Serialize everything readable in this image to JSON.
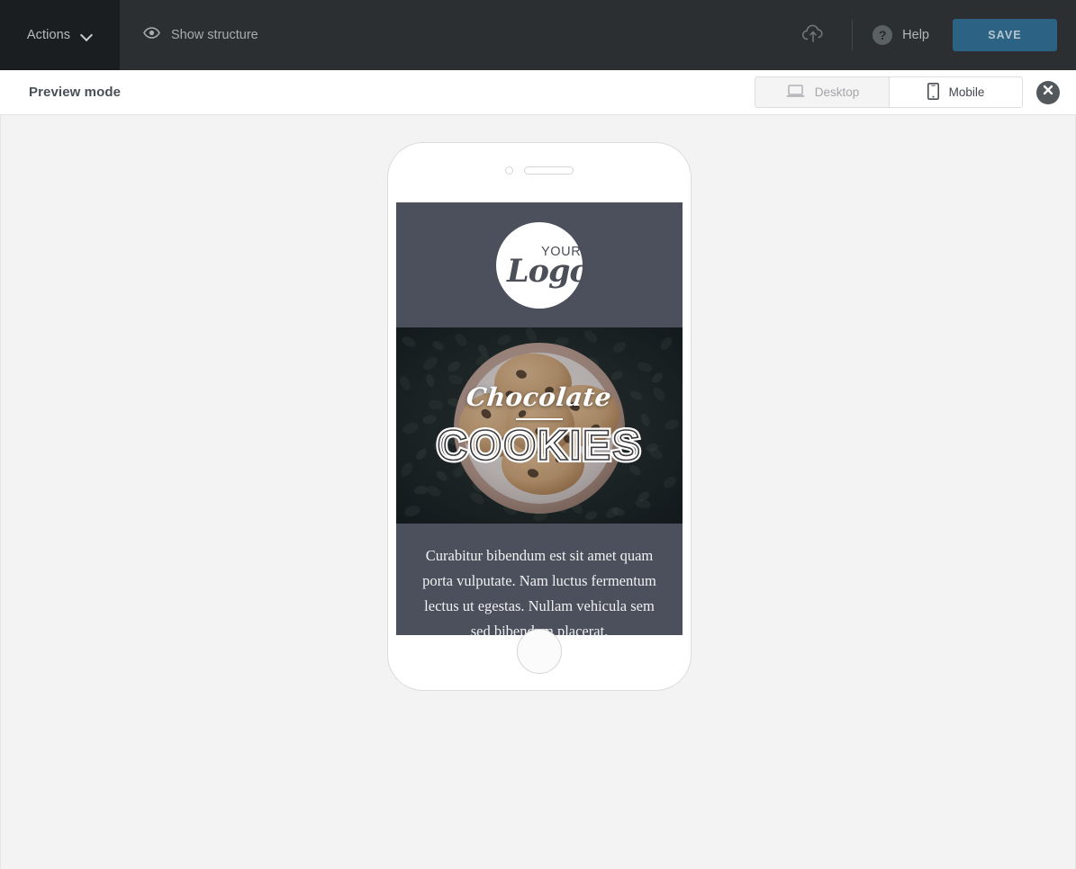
{
  "toolbar": {
    "actions_label": "Actions",
    "actions_chevron_icon": "chevron-down-icon",
    "show_structure_label": "Show structure",
    "show_structure_icon": "eye-icon",
    "upload_icon": "cloud-upload-icon",
    "help_label": "Help",
    "help_icon": "question-mark-icon",
    "save_label": "SAVE",
    "colors": {
      "toolbar_bg": "#2b2f31",
      "actions_bg": "#1b1e20",
      "save_bg": "#2c6384",
      "save_text": "#b6c5ce"
    }
  },
  "preview_bar": {
    "title": "Preview mode",
    "viewport_options": [
      {
        "label": "Desktop",
        "icon": "laptop-icon",
        "active": false
      },
      {
        "label": "Mobile",
        "icon": "smartphone-icon",
        "active": true
      }
    ],
    "close_icon": "close-circle-icon"
  },
  "stage": {
    "background": "#f3f3f3",
    "device": "mobile-phone-mockup"
  },
  "email": {
    "logo": {
      "top_word": "YOUR",
      "script_word": "Logo",
      "background": "#4c505c"
    },
    "hero": {
      "script_line": "Chocolate",
      "headline": "COOKIES",
      "image_alt": "chocolate-chip-cookies-in-bowl-on-coffee-beans"
    },
    "body": {
      "text": "Curabitur bibendum est sit amet quam porta vulputate. Nam luctus fermentum lectus ut egestas. Nullam vehicula sem sed bibendum placerat.",
      "background": "#4c505c"
    }
  }
}
